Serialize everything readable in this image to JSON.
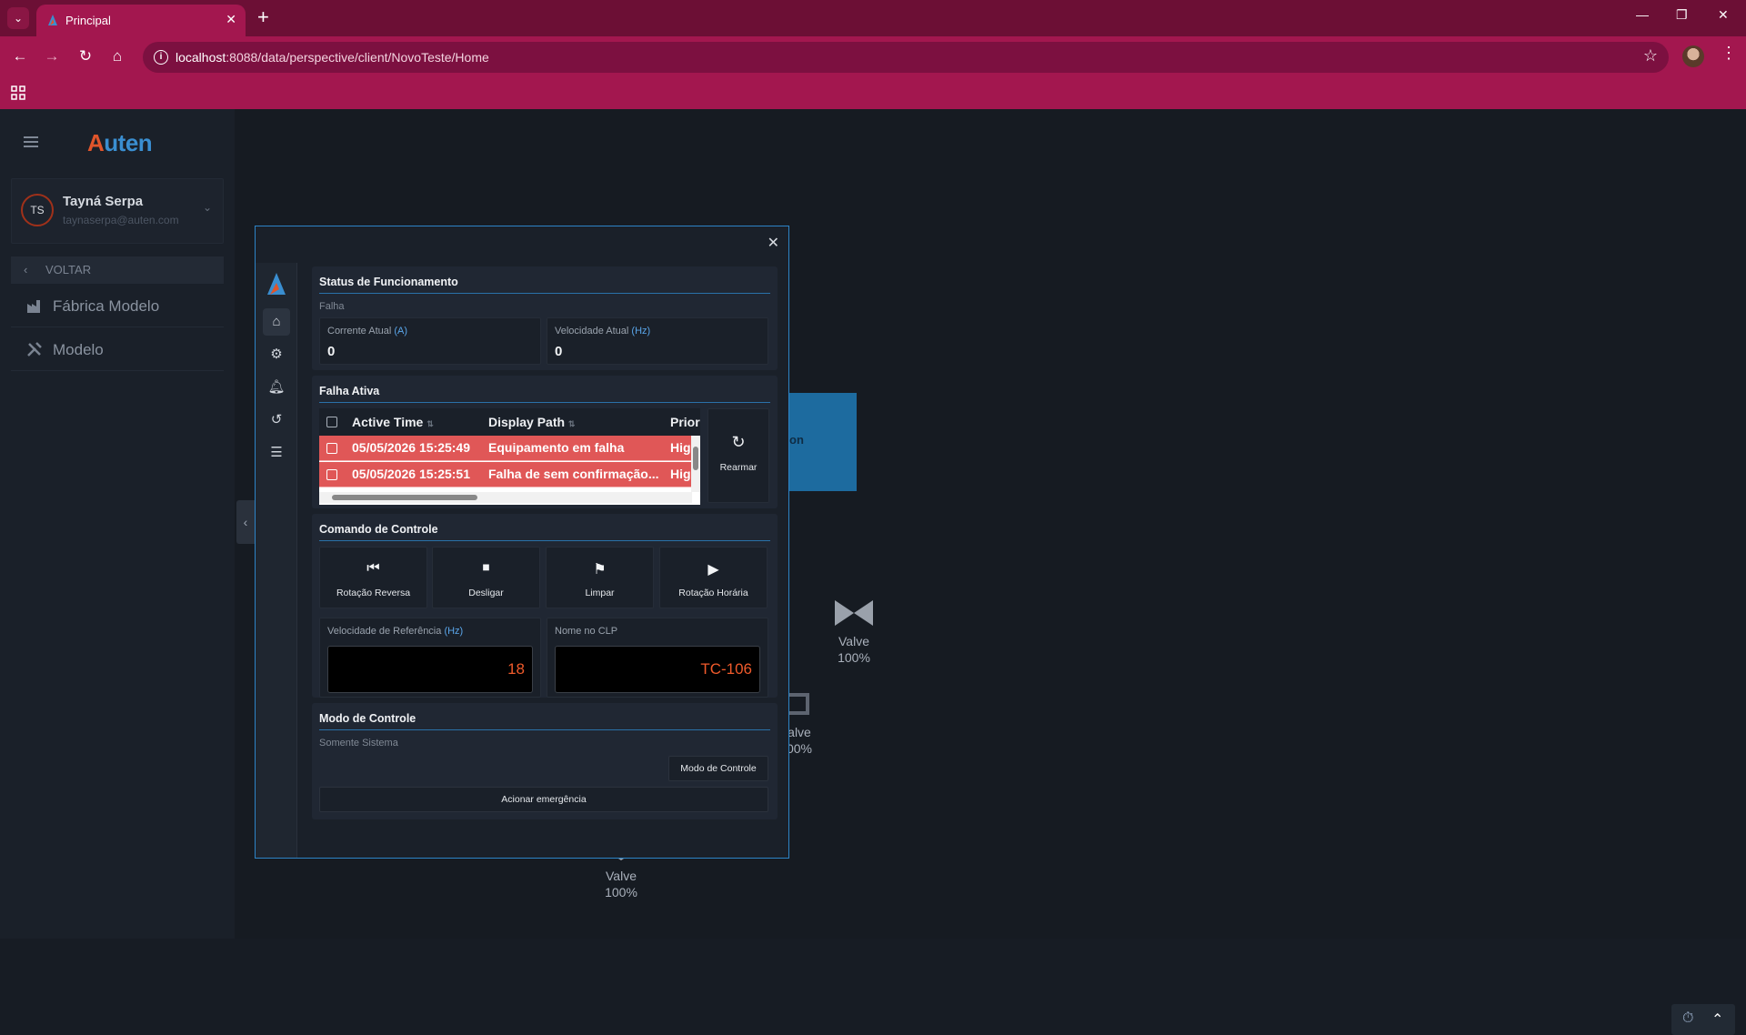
{
  "browser": {
    "tab_title": "Principal",
    "url_host": "localhost",
    "url_rest": ":8088/data/perspective/client/NovoTeste/Home",
    "theme_color": "#a3174f"
  },
  "sidebar": {
    "logo_a": "A",
    "logo_rest": "uten",
    "user_initials": "TS",
    "user_name": "Tayná Serpa",
    "user_email": "taynaserpa@auten.com",
    "back_label": "VOLTAR",
    "items": [
      {
        "label": "Fábrica Modelo",
        "icon": "factory-icon"
      },
      {
        "label": "Modelo",
        "icon": "tools-icon"
      }
    ]
  },
  "canvas": {
    "box_label": "on",
    "valves": [
      {
        "label": "Valve",
        "pct": "100%"
      },
      {
        "label": "alve",
        "pct": "00%"
      },
      {
        "label": "Valve",
        "pct": "100%"
      }
    ]
  },
  "modal": {
    "status": {
      "title": "Status de Funcionamento",
      "state": "Falha",
      "current_label": "Corrente Atual",
      "current_unit": "(A)",
      "current_value": "0",
      "speed_label": "Velocidade Atual",
      "speed_unit": "(Hz)",
      "speed_value": "0"
    },
    "alarms": {
      "title": "Falha Ativa",
      "columns": [
        "Active Time",
        "Display Path",
        "Prior"
      ],
      "rows": [
        {
          "time": "05/05/2026 15:25:49",
          "path": "Equipamento em falha",
          "priority": "Hig"
        },
        {
          "time": "05/05/2026 15:25:51",
          "path": "Falha de sem confirmação...",
          "priority": "Hig"
        }
      ],
      "rearm_label": "Rearmar",
      "alarm_color": "#e05757"
    },
    "control": {
      "title": "Comando de Controle",
      "buttons": [
        "Rotação Reversa",
        "Desligar",
        "Limpar",
        "Rotação Horária"
      ],
      "ref_speed_label": "Velocidade de Referência",
      "ref_speed_unit": "(Hz)",
      "ref_speed_value": "18",
      "plc_name_label": "Nome no CLP",
      "plc_name_value": "TC-106"
    },
    "mode": {
      "title": "Modo de Controle",
      "state": "Somente Sistema",
      "mode_button": "Modo de Controle",
      "emergency_button": "Acionar emergência"
    }
  }
}
